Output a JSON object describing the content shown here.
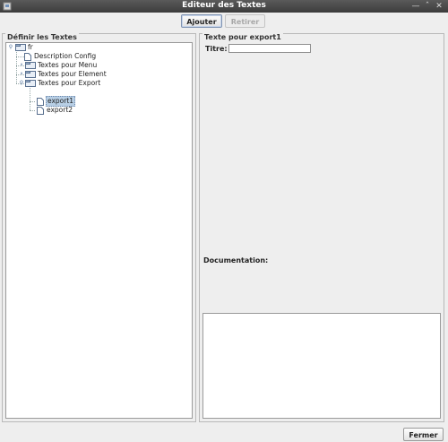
{
  "window": {
    "title": "Editeur des Textes",
    "icon": "java-app-icon",
    "controls": [
      "minimize-icon",
      "maximize-icon",
      "close-icon"
    ]
  },
  "toolbar": {
    "add_label": "Ajouter",
    "remove_label": "Retirer"
  },
  "left_panel": {
    "title": "Définir les Textes",
    "tree": {
      "root": "fr",
      "description_config": "Description Config",
      "menu": "Textes pour Menu",
      "element": "Textes pour Element",
      "export": "Textes pour Export",
      "export1": "export1",
      "export2": "export2"
    }
  },
  "right_panel": {
    "title": "Texte pour export1",
    "titre_label": "Titre:",
    "titre_value": "",
    "documentation_label": "Documentation:",
    "documentation_value": ""
  },
  "footer": {
    "close_label": "Fermer"
  }
}
